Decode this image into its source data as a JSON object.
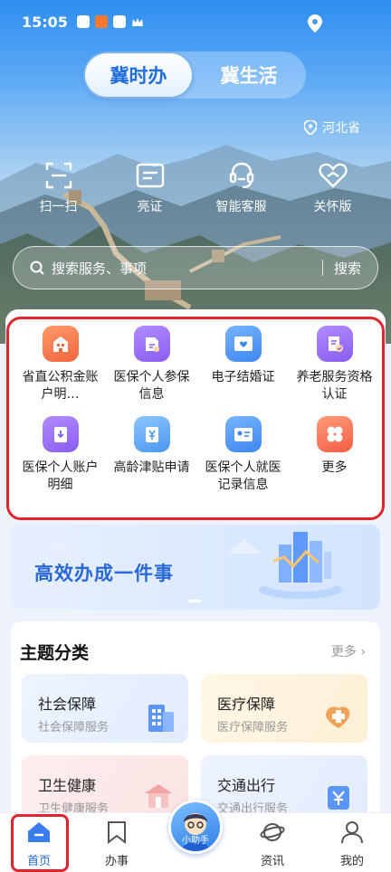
{
  "status_bar": {
    "time": "15:05"
  },
  "header": {
    "tabs": [
      {
        "label": "冀时办",
        "active": true
      },
      {
        "label": "冀生活",
        "active": false
      }
    ],
    "region": "河北省"
  },
  "quick_actions": [
    {
      "label": "扫一扫",
      "icon": "scan-icon"
    },
    {
      "label": "亮证",
      "icon": "id-card-icon"
    },
    {
      "label": "智能客服",
      "icon": "customer-service-icon"
    },
    {
      "label": "关怀版",
      "icon": "heart-icon"
    }
  ],
  "search": {
    "placeholder": "搜索服务、事项",
    "button": "搜索"
  },
  "services": [
    {
      "label": "省直公积金账户明…",
      "icon": "building-icon",
      "color": "#f2653c"
    },
    {
      "label": "医保个人参保信息",
      "icon": "insurance-doc-icon",
      "color": "#8a5cf0"
    },
    {
      "label": "电子结婚证",
      "icon": "marriage-certificate-icon",
      "color": "#3d87f0"
    },
    {
      "label": "养老服务资格认证",
      "icon": "certification-icon",
      "color": "#8a5cf0"
    },
    {
      "label": "医保个人账户明细",
      "icon": "account-detail-icon",
      "color": "#8a5cf0"
    },
    {
      "label": "高龄津贴申请",
      "icon": "allowance-icon",
      "color": "#4b97f2"
    },
    {
      "label": "医保个人就医记录信息",
      "icon": "medical-record-icon",
      "color": "#3d87f0"
    },
    {
      "label": "更多",
      "icon": "more-grid-icon",
      "color": "#f45e44"
    }
  ],
  "banner": {
    "title": "高效办成一件事"
  },
  "categories": {
    "title": "主题分类",
    "more": "更多",
    "items": [
      {
        "name": "社会保障",
        "sub": "社会保障服务",
        "icon": "social-security-icon"
      },
      {
        "name": "医疗保障",
        "sub": "医疗保障服务",
        "icon": "medical-icon"
      },
      {
        "name": "卫生健康",
        "sub": "卫生健康服务",
        "icon": "health-icon"
      },
      {
        "name": "交通出行",
        "sub": "交通出行服务",
        "icon": "transport-icon"
      }
    ]
  },
  "tab_bar": {
    "items": [
      {
        "label": "首页",
        "icon": "home-icon",
        "active": true
      },
      {
        "label": "办事",
        "icon": "bookmark-icon",
        "active": false
      },
      {
        "label": "资讯",
        "icon": "planet-icon",
        "active": false
      },
      {
        "label": "我的",
        "icon": "user-icon",
        "active": false
      }
    ],
    "assistant_label": "小助手"
  },
  "colors": {
    "accent": "#2a68d8",
    "highlight": "#e2242f"
  }
}
